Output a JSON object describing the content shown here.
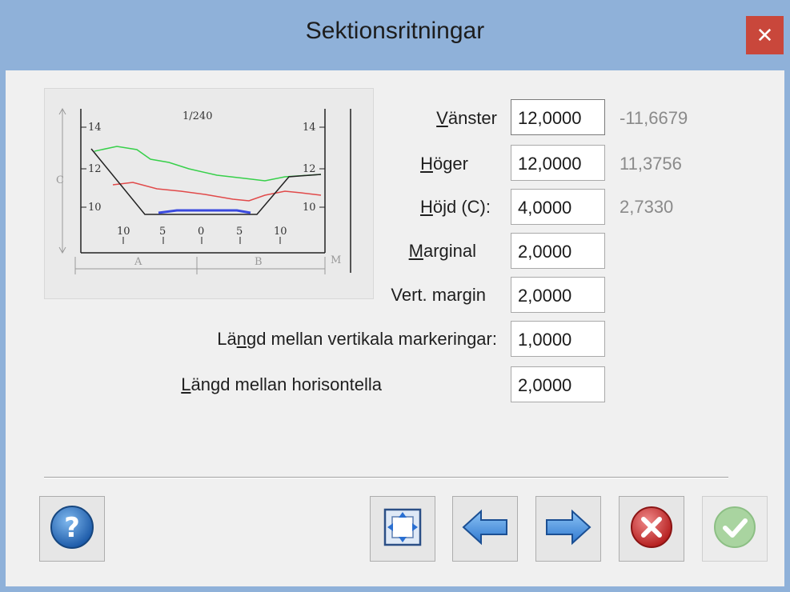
{
  "window": {
    "title": "Sektionsritningar"
  },
  "preview": {
    "scale": "1/240",
    "y_ticks_left": [
      "14",
      "12",
      "10"
    ],
    "y_ticks_right": [
      "14",
      "12",
      "10"
    ],
    "x_ticks": [
      "10",
      "5",
      "0",
      "5",
      "10"
    ],
    "c_label": "C",
    "a_label": "A",
    "b_label": "B",
    "m_label": "M"
  },
  "fields": [
    {
      "label_pre": "",
      "label_u": "V",
      "label_post": "änster",
      "value": "12,0000",
      "computed": "-11,6679"
    },
    {
      "label_pre": "",
      "label_u": "H",
      "label_post": "öger",
      "value": "12,0000",
      "computed": "11,3756"
    },
    {
      "label_pre": "",
      "label_u": "H",
      "label_post": "öjd (C):",
      "value": "4,0000",
      "computed": "2,7330"
    },
    {
      "label_pre": "",
      "label_u": "M",
      "label_post": "arginal",
      "value": "2,0000",
      "computed": ""
    },
    {
      "label_pre": "Vert. margin",
      "label_u": "",
      "label_post": "",
      "value": "2,0000",
      "computed": ""
    },
    {
      "label_pre": "Lä",
      "label_u": "n",
      "label_post": "gd mellan vertikala markeringar:",
      "value": "1,0000",
      "computed": ""
    },
    {
      "label_pre": "",
      "label_u": "L",
      "label_post": "ängd mellan horisontella",
      "value": "2,0000",
      "computed": ""
    }
  ],
  "buttons": {
    "help": "help-icon",
    "fit": "fit-view-icon",
    "back": "arrow-left-icon",
    "forward": "arrow-right-icon",
    "cancel": "cancel-icon",
    "ok": "ok-check-icon"
  }
}
